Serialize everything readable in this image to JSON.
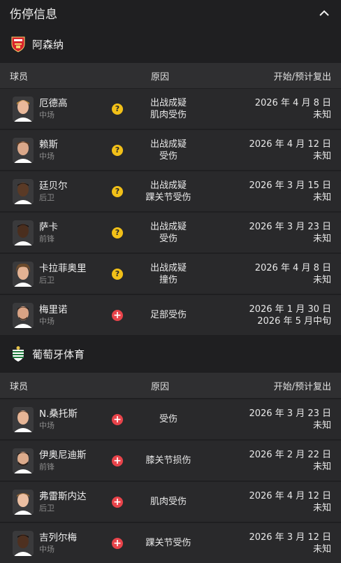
{
  "header": {
    "title": "伤停信息"
  },
  "columns": {
    "player": "球员",
    "reason": "原因",
    "dates": "开始/预计复出"
  },
  "teams": [
    {
      "name": "阿森纳",
      "players": [
        {
          "name": "厄德高",
          "position": "中场",
          "status": "question",
          "reason1": "出战成疑",
          "reason2": "肌肉受伤",
          "start": "2026 年 4 月 8 日",
          "return": "未知"
        },
        {
          "name": "赖斯",
          "position": "中场",
          "status": "question",
          "reason1": "出战成疑",
          "reason2": "受伤",
          "start": "2026 年 4 月 12 日",
          "return": "未知"
        },
        {
          "name": "廷贝尔",
          "position": "后卫",
          "status": "question",
          "reason1": "出战成疑",
          "reason2": "踝关节受伤",
          "start": "2026 年 3 月 15 日",
          "return": "未知"
        },
        {
          "name": "萨卡",
          "position": "前锋",
          "status": "question",
          "reason1": "出战成疑",
          "reason2": "受伤",
          "start": "2026 年 3 月 23 日",
          "return": "未知"
        },
        {
          "name": "卡拉菲奥里",
          "position": "后卫",
          "status": "question",
          "reason1": "出战成疑",
          "reason2": "撞伤",
          "start": "2026 年 4 月 8 日",
          "return": "未知"
        },
        {
          "name": "梅里诺",
          "position": "中场",
          "status": "injured",
          "reason1": "足部受伤",
          "reason2": "",
          "start": "2026 年 1 月 30 日",
          "return": "2026 年 5 月中旬"
        }
      ]
    },
    {
      "name": "葡萄牙体育",
      "players": [
        {
          "name": "N.桑托斯",
          "position": "中场",
          "status": "injured",
          "reason1": "受伤",
          "reason2": "",
          "start": "2026 年 3 月 23 日",
          "return": "未知"
        },
        {
          "name": "伊奥尼迪斯",
          "position": "前锋",
          "status": "injured",
          "reason1": "膝关节损伤",
          "reason2": "",
          "start": "2026 年 2 月 22 日",
          "return": "未知"
        },
        {
          "name": "弗雷斯内达",
          "position": "后卫",
          "status": "injured",
          "reason1": "肌肉受伤",
          "reason2": "",
          "start": "2026 年 4 月 12 日",
          "return": "未知"
        },
        {
          "name": "吉列尔梅",
          "position": "中场",
          "status": "injured",
          "reason1": "踝关节受伤",
          "reason2": "",
          "start": "2026 年 3 月 12 日",
          "return": "未知"
        }
      ]
    }
  ],
  "icons": {
    "collapse": "chevron-up-icon",
    "question": "question-icon",
    "injured": "medical-cross-icon"
  },
  "colors": {
    "question": "#f2c018",
    "injured": "#e8434a",
    "arsenal": "#d8242c",
    "sporting": "#1f7a3e"
  }
}
